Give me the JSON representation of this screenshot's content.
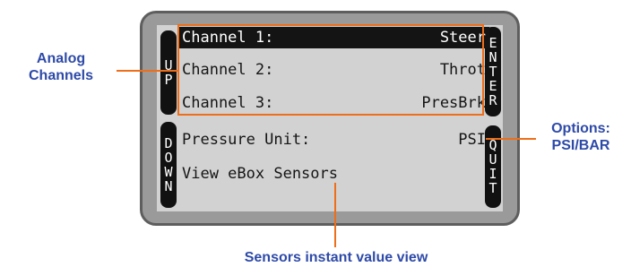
{
  "callouts": {
    "analog": [
      "Analog",
      "Channels"
    ],
    "options": [
      "Options:",
      "PSI/BAR"
    ],
    "sensors": "Sensors instant value view"
  },
  "buttons": {
    "up": "UP",
    "down": "DOWN",
    "enter": "ENTER",
    "quit": "QUIT"
  },
  "menu": {
    "channels": [
      {
        "label": "Channel 1:",
        "value": "Steer",
        "selected": true
      },
      {
        "label": "Channel 2:",
        "value": "Throt",
        "selected": false
      },
      {
        "label": "Channel 3:",
        "value": "PresBrk",
        "selected": false
      }
    ],
    "pressure": {
      "label": "Pressure Unit:",
      "value": "PSI"
    },
    "sensors": {
      "label": "View eBox Sensors"
    }
  },
  "colors": {
    "callout_text": "#2e4aa8",
    "highlight": "#ee6e1a",
    "lcd": "#d2d2d2",
    "bezel": "#9a9a9a"
  }
}
